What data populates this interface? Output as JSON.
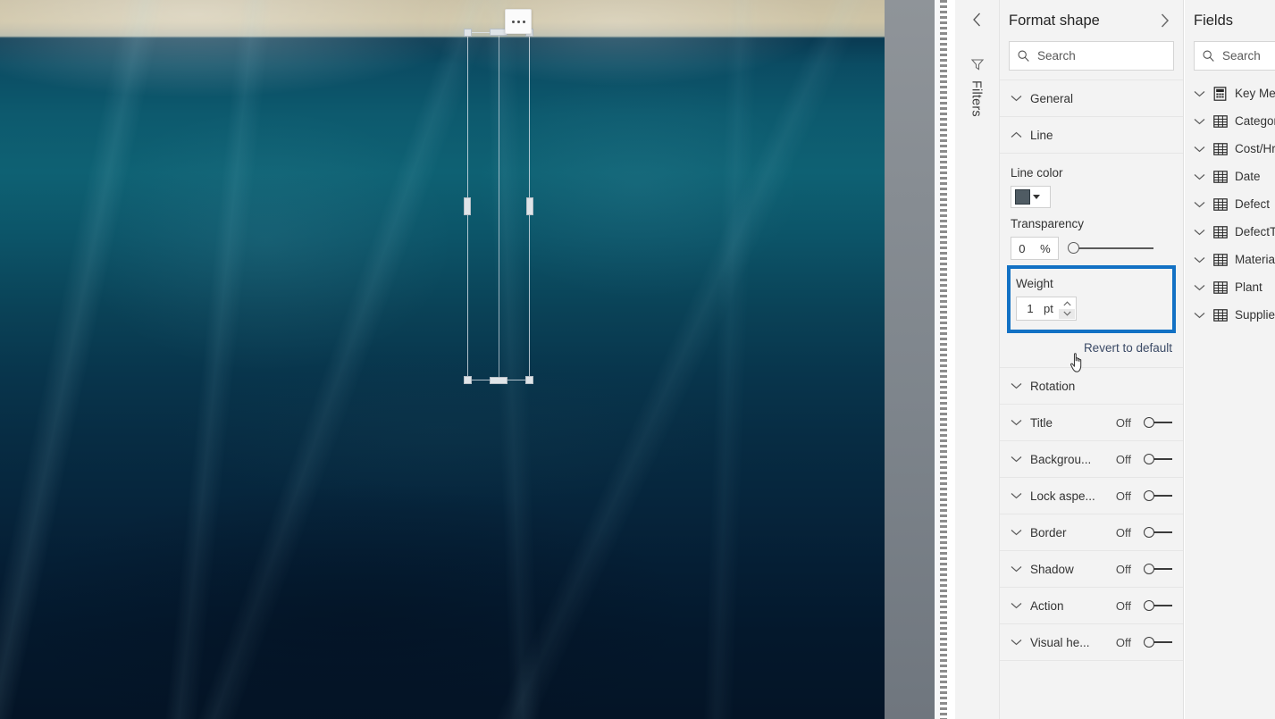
{
  "canvas": {
    "more_options_label": "More options",
    "shape_name": "line-shape",
    "background_description": "underwater-photo"
  },
  "filters_rail": {
    "collapse_label": "<",
    "filter_icon": "funnel-icon",
    "label": "Filters"
  },
  "format_pane": {
    "title": "Format shape",
    "expand_icon": ">",
    "search": {
      "placeholder": "Search",
      "value": "",
      "icon": "search-icon"
    },
    "sections": [
      {
        "label": "General",
        "expanded": false
      },
      {
        "label": "Line",
        "expanded": true
      }
    ],
    "line": {
      "line_color_label": "Line color",
      "line_color_value": "#4F5B63",
      "transparency_label": "Transparency",
      "transparency_value": "0",
      "transparency_unit": "%",
      "weight_label": "Weight",
      "weight_value": "1",
      "weight_unit": "pt",
      "spinner_up": "chevron-up",
      "spinner_down": "chevron-down",
      "highlight_color": "#1271C4"
    },
    "revert_label": "Revert to default",
    "toggle_sections": [
      {
        "label": "Rotation",
        "has_toggle": false,
        "state": ""
      },
      {
        "label": "Title",
        "has_toggle": true,
        "state": "Off"
      },
      {
        "label": "Backgrou...",
        "has_toggle": true,
        "state": "Off"
      },
      {
        "label": "Lock aspe...",
        "has_toggle": true,
        "state": "Off"
      },
      {
        "label": "Border",
        "has_toggle": true,
        "state": "Off"
      },
      {
        "label": "Shadow",
        "has_toggle": true,
        "state": "Off"
      },
      {
        "label": "Action",
        "has_toggle": true,
        "state": "Off"
      },
      {
        "label": "Visual he...",
        "has_toggle": true,
        "state": "Off"
      }
    ]
  },
  "fields_pane": {
    "title": "Fields",
    "search": {
      "placeholder": "Search",
      "value": "",
      "icon": "search-icon"
    },
    "items": [
      {
        "label": "Key Me",
        "icon": "measure-icon"
      },
      {
        "label": "Categor",
        "icon": "table-icon"
      },
      {
        "label": "Cost/Hr",
        "icon": "table-icon"
      },
      {
        "label": "Date",
        "icon": "table-icon"
      },
      {
        "label": "Defect",
        "icon": "table-icon"
      },
      {
        "label": "DefectT",
        "icon": "table-icon"
      },
      {
        "label": "Materia",
        "icon": "table-icon"
      },
      {
        "label": "Plant",
        "icon": "table-icon"
      },
      {
        "label": "Supplie",
        "icon": "table-icon"
      }
    ]
  }
}
